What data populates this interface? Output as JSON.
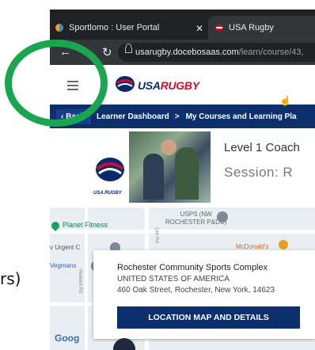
{
  "left_partial_text": "rs)",
  "browser": {
    "tabs": [
      {
        "label": "Sportlomo : User Portal"
      },
      {
        "label": "USA Rugby"
      }
    ],
    "url_host": "usarugby.docebosaas.com",
    "url_path": "/learn/course/43,"
  },
  "site": {
    "logo_label_usa": "USA",
    "logo_label_rugby": "RUGBY"
  },
  "breadcrumb": {
    "back_label": "Back",
    "items": [
      "Learner Dashboard",
      "My Courses and Learning Pla"
    ],
    "separators": [
      ">",
      ">"
    ]
  },
  "course": {
    "logo_text": "USA RUGBY",
    "title": "Level 1 Coach",
    "session_label": "Session: R"
  },
  "map": {
    "labels": {
      "planet_fitness": "Planet Fitness",
      "usps": "USPS (NW",
      "usps2": "ROCHESTER P&DC)",
      "mcdonalds": "McDonald's",
      "urgent": "v Urgent C",
      "wegmans": "Vegmans",
      "howard": "Howard Rd",
      "lee": "Lee Rd"
    },
    "google": "Goog"
  },
  "location": {
    "name": "Rochester Community Sports Complex",
    "country": "UNITED STATES OF AMERICA",
    "address": "460 Oak Street, Rochester, New York, 14623",
    "button_label": "LOCATION MAP AND DETAILS"
  },
  "colors": {
    "brand_navy": "#0d2f6b",
    "annotation_green": "#1aa64e",
    "tab_dark": "#202124"
  }
}
